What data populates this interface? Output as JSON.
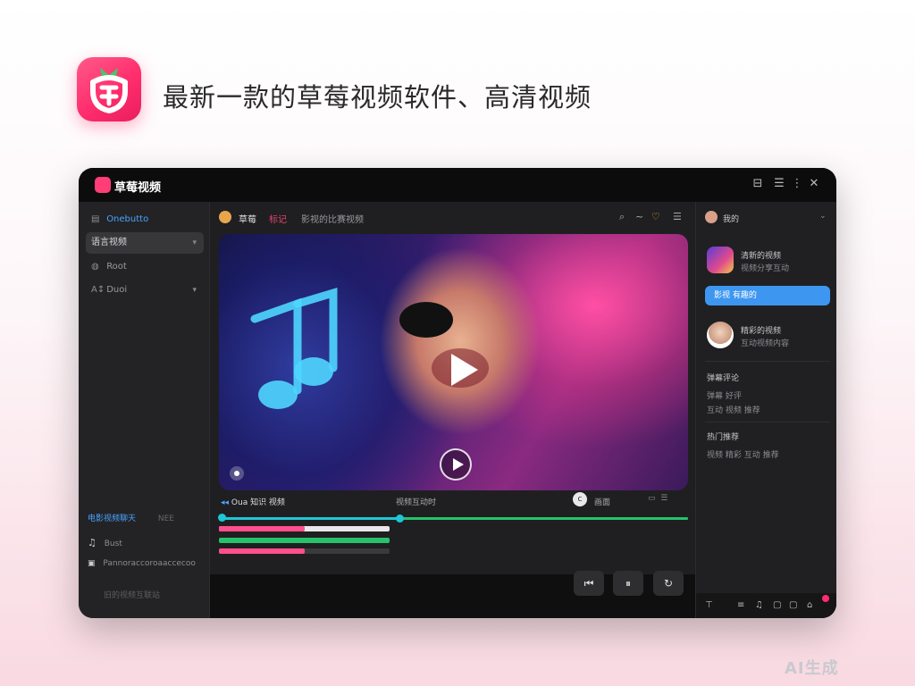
{
  "headline": "最新一款的草莓视频软件、高清视频",
  "watermark": "AI生成",
  "app": {
    "title": "草莓视频",
    "window_controls": [
      "⊟",
      "☰",
      "⋮",
      "✕"
    ]
  },
  "sidebar": {
    "items": [
      {
        "icon": "▤",
        "label": "Onebutto"
      },
      {
        "icon": "",
        "label": "语言视频",
        "chevron": "▾"
      },
      {
        "icon": "◍",
        "label": "Root"
      },
      {
        "icon": "A↕",
        "label": "Duoi",
        "chevron": "▾"
      }
    ],
    "footer": [
      {
        "label": "电影视频聊天",
        "extra": "NEE"
      },
      {
        "icon": "♫",
        "label": "Bust"
      },
      {
        "icon": "▣",
        "label": "Pannoraccoroaaccecoo"
      },
      {
        "label": "旧的视频互联站"
      }
    ]
  },
  "channel": {
    "name": "草莓",
    "sub": "标记",
    "info": "影视的比赛视频",
    "icons": [
      "⌕",
      "~",
      "♡",
      "☰"
    ]
  },
  "player": {
    "left_label": "Oua 知识 视频",
    "center_label": "视频互动时",
    "right_label": "画面",
    "progress_main": 0.33,
    "bars": [
      {
        "color": "#ff4f8b",
        "fill": 0.5,
        "rest": "#e8e8ea"
      },
      {
        "color": "#27c26b",
        "fill": 1.0,
        "rest": "#27c26b"
      },
      {
        "color": "#ff4f8b",
        "fill": 0.5,
        "rest": "#3a3a3d"
      }
    ],
    "buttons": [
      "⏮",
      "⏸",
      "↻"
    ]
  },
  "right_panel": {
    "user": "我的",
    "creator1": {
      "name": "清新的视频",
      "sub": "视频分享互动"
    },
    "follow_button": "影视 有趣的",
    "creator2": {
      "name": "精彩的视频",
      "sub": "互动视频内容"
    },
    "section1": {
      "title": "弹幕评论",
      "lines": [
        "弹幕 好评",
        "互动 视频 推荐"
      ]
    },
    "section2": {
      "title": "热门推荐",
      "lines": [
        "视频 精彩 互动 推荐"
      ]
    },
    "bottom_icons": [
      "⊤",
      "≡",
      "♫",
      "▢",
      "▢",
      "⌂"
    ]
  },
  "colors": {
    "accent": "#ff2d6d",
    "blue": "#3d97f0",
    "green": "#27c26b",
    "cyan": "#1fc7d6"
  }
}
